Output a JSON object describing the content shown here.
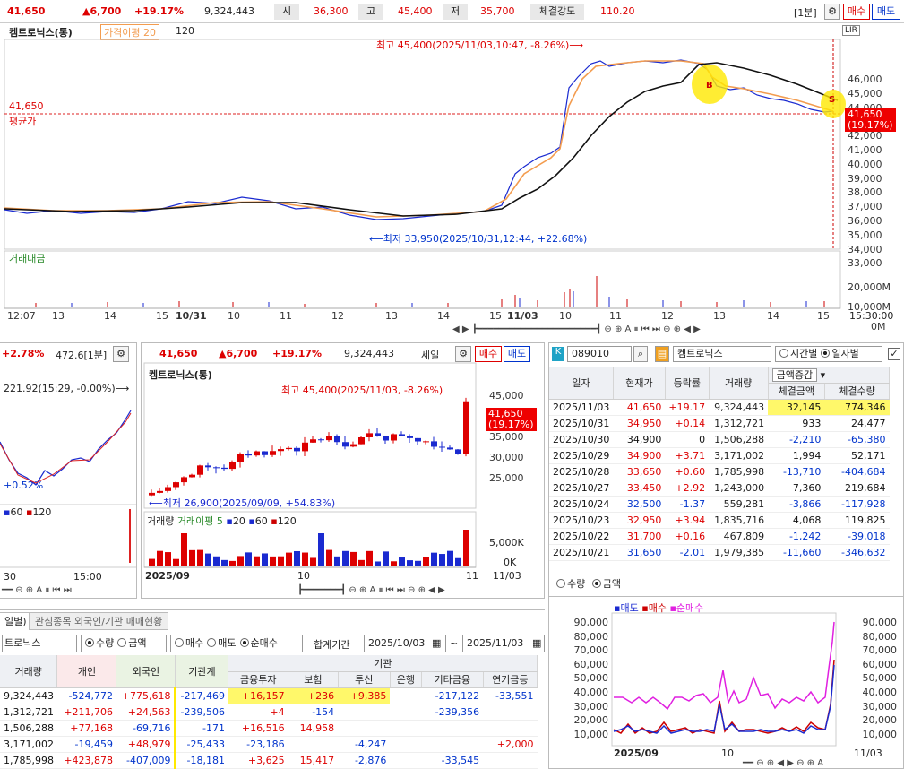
{
  "top": {
    "price": "41,650",
    "change": "▲6,700",
    "pct": "+19.17%",
    "volume": "9,324,443",
    "open_lbl": "시",
    "open": "36,300",
    "high_lbl": "고",
    "high": "45,400",
    "low_lbl": "저",
    "low": "35,700",
    "strength_lbl": "체결강도",
    "strength": "110.20",
    "period": "[1분]",
    "buy": "매수",
    "sell": "매도"
  },
  "main_chart": {
    "name": "켐트로닉스(통)",
    "ma_label": "가격이평 20",
    "ma_val": "120",
    "max_note": "최고 45,400(2025/11/03,10:47, -8.26%)⟶",
    "min_note": "⟵최저 33,950(2025/10/31,12:44, +22.68%)",
    "avg_price": "41,650",
    "avg_label": "평균가",
    "cur_box_1": "41,650",
    "cur_box_2": "(19.17%)",
    "y_ticks": [
      "46,000",
      "45,000",
      "44,000",
      "43,000",
      "42,000",
      "41,000",
      "40,000",
      "39,000",
      "38,000",
      "37,000",
      "36,000",
      "35,000",
      "34,000",
      "33,000"
    ],
    "vol_label": "거래대금",
    "vol_ticks": [
      "20,000M",
      "10,000M",
      "0M"
    ],
    "x_ticks": [
      "12:07",
      "13",
      "14",
      "15",
      "10/31",
      "10",
      "11",
      "12",
      "13",
      "14",
      "15",
      "11/03",
      "10",
      "11",
      "12",
      "13",
      "14",
      "15"
    ],
    "time_box": "15:30:00",
    "marker_b": "B",
    "marker_s": "S"
  },
  "mini_left": {
    "pct": "+2.78%",
    "val": "472.6[1분]",
    "note": "221.92(15:29, -0.00%)⟶",
    "note2": "+0.52%",
    "legend_60": "60",
    "legend_120": "120",
    "x1": "30",
    "x2": "15:00"
  },
  "daily_chart": {
    "price": "41,650",
    "change": "▲6,700",
    "pct": "+19.17%",
    "volume": "9,324,443",
    "period": "세일",
    "buy": "매수",
    "sell": "매도",
    "name": "켐트로닉스(통)",
    "max_note": "최고 45,400(2025/11/03, -8.26%)",
    "min_note": "⟵최저 26,900(2025/09/09, +54.83%)",
    "y_ticks": [
      "45,000",
      "40,000",
      "35,000",
      "30,000",
      "25,000"
    ],
    "cur_box_1": "41,650",
    "cur_box_2": "(19.17%)",
    "vol_label": "거래량",
    "vol_ma": "거래이평 5",
    "vol_20": "20",
    "vol_60": "60",
    "vol_120": "120",
    "vol_ticks": [
      "5,000K",
      "0K"
    ],
    "x_start": "2025/09",
    "x_mid": "10",
    "x_mid2": "11",
    "x_end": "11/03"
  },
  "right_panel": {
    "code": "089010",
    "name": "켐트로닉스",
    "opt_time": "시간별",
    "opt_day": "일자별",
    "sel": "금액증감",
    "headers": [
      "일자",
      "현재가",
      "등락률",
      "거래량",
      "체결금액",
      "체결수량"
    ],
    "rows": [
      {
        "d": "2025/11/03",
        "p": "41,650",
        "r": "+19.17",
        "v": "9,324,443",
        "a": "32,145",
        "q": "774,346"
      },
      {
        "d": "2025/10/31",
        "p": "34,950",
        "r": "+0.14",
        "v": "1,312,721",
        "a": "933",
        "q": "24,477"
      },
      {
        "d": "2025/10/30",
        "p": "34,900",
        "r": "0",
        "v": "1,506,288",
        "a": "-2,210",
        "q": "-65,380"
      },
      {
        "d": "2025/10/29",
        "p": "34,900",
        "r": "+3.71",
        "v": "3,171,002",
        "a": "1,994",
        "q": "52,171"
      },
      {
        "d": "2025/10/28",
        "p": "33,650",
        "r": "+0.60",
        "v": "1,785,998",
        "a": "-13,710",
        "q": "-404,684"
      },
      {
        "d": "2025/10/27",
        "p": "33,450",
        "r": "+2.92",
        "v": "1,243,000",
        "a": "7,360",
        "q": "219,684"
      },
      {
        "d": "2025/10/24",
        "p": "32,500",
        "r": "-1.37",
        "v": "559,281",
        "a": "-3,866",
        "q": "-117,928"
      },
      {
        "d": "2025/10/23",
        "p": "32,950",
        "r": "+3.94",
        "v": "1,835,716",
        "a": "4,068",
        "q": "119,825"
      },
      {
        "d": "2025/10/22",
        "p": "31,700",
        "r": "+0.16",
        "v": "467,809",
        "a": "-1,242",
        "q": "-39,018"
      },
      {
        "d": "2025/10/21",
        "p": "31,650",
        "r": "-2.01",
        "v": "1,979,385",
        "a": "-11,660",
        "q": "-346,632"
      }
    ],
    "opt_qty": "수량",
    "opt_amt": "금액",
    "legend_sell": "매도",
    "legend_buy": "매수",
    "legend_net": "순매수",
    "y_ticks": [
      "90,000",
      "80,000",
      "70,000",
      "60,000",
      "50,000",
      "40,000",
      "30,000",
      "20,000",
      "10,000"
    ],
    "x_start": "2025/09",
    "x_mid": "10",
    "x_end": "11/03"
  },
  "bottom": {
    "tab1": "일별)",
    "tab2": "관심종목 외국인/기관 매매현황",
    "name": "트로닉스",
    "opt_qty": "수량",
    "opt_amt": "금액",
    "opt_buy": "매수",
    "opt_sell": "매도",
    "opt_net": "순매수",
    "sum_label": "합계기간",
    "date_from": "2025/10/03",
    "tilde": "~",
    "date_to": "2025/11/03",
    "headers": [
      "거래량",
      "개인",
      "외국인",
      "기관계"
    ],
    "inst_header": "기관",
    "inst_sub": [
      "금융투자",
      "보험",
      "투신",
      "은행",
      "기타금융",
      "연기금등"
    ],
    "rows": [
      {
        "v": "9,324,443",
        "ind": "-524,772",
        "for": "+775,618",
        "inst": "-217,469",
        "fin": "+16,157",
        "ins": "+236",
        "tr": "+9,385",
        "bank": "",
        "etc": "-217,122",
        "pen": "-33,551"
      },
      {
        "v": "1,312,721",
        "ind": "+211,706",
        "for": "+24,563",
        "inst": "-239,506",
        "fin": "+4",
        "ins": "-154",
        "tr": "",
        "bank": "",
        "etc": "-239,356",
        "pen": ""
      },
      {
        "v": "1,506,288",
        "ind": "+77,168",
        "for": "-69,716",
        "inst": "-171",
        "fin": "+16,516",
        "ins": "14,958",
        "tr": "",
        "bank": "",
        "etc": "",
        "pen": ""
      },
      {
        "v": "3,171,002",
        "ind": "-19,459",
        "for": "+48,979",
        "inst": "-25,433",
        "fin": "-23,186",
        "ins": "",
        "tr": "-4,247",
        "bank": "",
        "etc": "",
        "pen": "+2,000"
      },
      {
        "v": "1,785,998",
        "ind": "+423,878",
        "for": "-407,009",
        "inst": "-18,181",
        "fin": "+3,625",
        "ins": "15,417",
        "tr": "-2,876",
        "bank": "",
        "etc": "-33,545",
        "pen": ""
      }
    ]
  }
}
